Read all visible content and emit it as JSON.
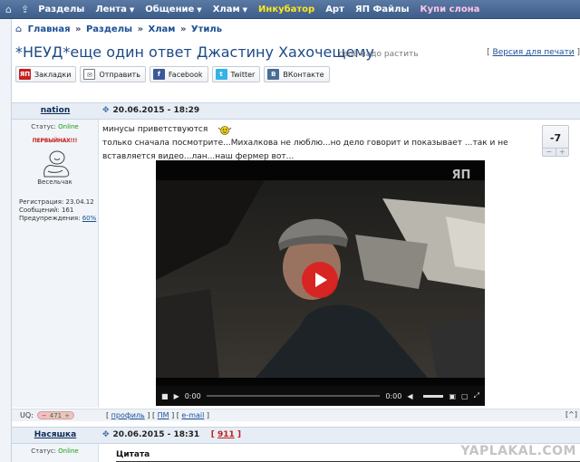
{
  "nav": {
    "items": [
      {
        "label": "Разделы",
        "dropdown": false
      },
      {
        "label": "Лента",
        "dropdown": true
      },
      {
        "label": "Общение",
        "dropdown": true
      },
      {
        "label": "Хлам",
        "dropdown": true
      },
      {
        "label": "Инкубатор",
        "dropdown": false,
        "color": "#ffe81a"
      },
      {
        "label": "Арт",
        "dropdown": false
      },
      {
        "label": "ЯП Файлы",
        "dropdown": false
      },
      {
        "label": "Купи слона",
        "dropdown": false,
        "color": "#ffc6e8"
      }
    ]
  },
  "breadcrumb": {
    "items": [
      "Главная",
      "Разделы",
      "Хлам",
      "Утиль"
    ],
    "separator": "»"
  },
  "topic": {
    "title": "*НЕУД*еще один ответ Джастину Хахочещему",
    "subtitle": ", своё надо растить",
    "print_label": "Версия для печати"
  },
  "share": {
    "buttons": [
      {
        "label": "Закладки",
        "icon": "ЯП"
      },
      {
        "label": "Отправить",
        "icon": "✉"
      },
      {
        "label": "Facebook",
        "icon": "f"
      },
      {
        "label": "Twitter",
        "icon": "t"
      },
      {
        "label": "ВКонтакте",
        "icon": "B"
      }
    ]
  },
  "post1": {
    "author": "nation",
    "date": "20.06.2015 - 18:29",
    "status_label": "Статус:",
    "status_value": "Online",
    "rank": "ПЕРВЫЙНАХ!!!",
    "avatar_caption": "Весельчак",
    "reg_label": "Регистрация:",
    "reg_value": "23.04.12",
    "msgs_label": "Сообщений:",
    "msgs_value": "161",
    "warn_label": "Предупреждения:",
    "warn_value": "60%",
    "line1": "минусы приветствуются",
    "line2": "только сначала посмотрите...Михалкова не люблю...но дело говорит и показывает ...так и не",
    "line3": "вставляется видео...лан...наш фермер вот...",
    "rating": "-7",
    "rating_minus": "−",
    "rating_plus": "+",
    "video": {
      "logo": "ЯП",
      "time_current": "0:00",
      "time_total": "0:00"
    },
    "uq_label": "UQ:",
    "uq_value": "471",
    "links": [
      "профиль",
      "ПМ",
      "e-mail"
    ],
    "up_label": "[^]"
  },
  "post2": {
    "author": "Насяшка",
    "date": "20.06.2015 - 18:31",
    "post_number": "911",
    "status_label": "Статус:",
    "status_value": "Online",
    "quote_label": "Цитата"
  },
  "watermark": "YAPLAKAL.COM",
  "colors": {
    "nav_bg": "#3e5e8b",
    "link": "#1b4f95",
    "title": "#1c4a86",
    "online": "#1a9a16",
    "accent_red": "#c21d1d"
  }
}
